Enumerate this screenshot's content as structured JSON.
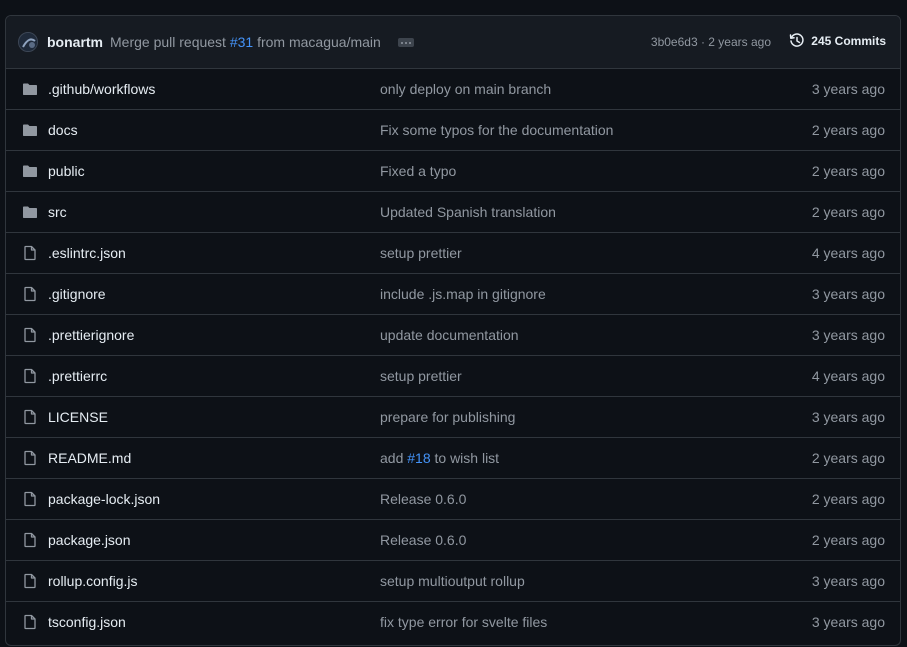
{
  "header": {
    "author": "bonartm",
    "message_prefix": "Merge pull request ",
    "message_link": "#31",
    "message_suffix": " from macagua/main",
    "sha_time": "3b0e6d3 · 2 years ago",
    "commits_label": "245 Commits",
    "icons": {
      "avatar": "user-avatar",
      "ellipsis": "kebab-horizontal-icon",
      "history": "history-icon"
    }
  },
  "files": [
    {
      "name": ".github/workflows",
      "type": "folder",
      "msg": "only deploy on main branch",
      "age": "3 years ago"
    },
    {
      "name": "docs",
      "type": "folder",
      "msg": "Fix some typos for the documentation",
      "age": "2 years ago"
    },
    {
      "name": "public",
      "type": "folder",
      "msg": "Fixed a typo",
      "age": "2 years ago"
    },
    {
      "name": "src",
      "type": "folder",
      "msg": "Updated Spanish translation",
      "age": "2 years ago"
    },
    {
      "name": ".eslintrc.json",
      "type": "file",
      "msg": "setup prettier",
      "age": "4 years ago"
    },
    {
      "name": ".gitignore",
      "type": "file",
      "msg": "include .js.map in gitignore",
      "age": "3 years ago"
    },
    {
      "name": ".prettierignore",
      "type": "file",
      "msg": "update documentation",
      "age": "3 years ago"
    },
    {
      "name": ".prettierrc",
      "type": "file",
      "msg": "setup prettier",
      "age": "4 years ago"
    },
    {
      "name": "LICENSE",
      "type": "file",
      "msg": "prepare for publishing",
      "age": "3 years ago"
    },
    {
      "name": "README.md",
      "type": "file",
      "msg_prefix": "add ",
      "msg_link": "#18",
      "msg_suffix": " to wish list",
      "age": "2 years ago"
    },
    {
      "name": "package-lock.json",
      "type": "file",
      "msg": "Release 0.6.0",
      "age": "2 years ago"
    },
    {
      "name": "package.json",
      "type": "file",
      "msg": "Release 0.6.0",
      "age": "2 years ago"
    },
    {
      "name": "rollup.config.js",
      "type": "file",
      "msg": "setup multioutput rollup",
      "age": "3 years ago"
    },
    {
      "name": "tsconfig.json",
      "type": "file",
      "msg": "fix type error for svelte files",
      "age": "3 years ago"
    }
  ],
  "colors": {
    "background": "#0d1117",
    "header_bg": "#161b22",
    "border": "#30363d",
    "text": "#e6edf3",
    "muted": "#9198a1",
    "link": "#4493f8"
  }
}
